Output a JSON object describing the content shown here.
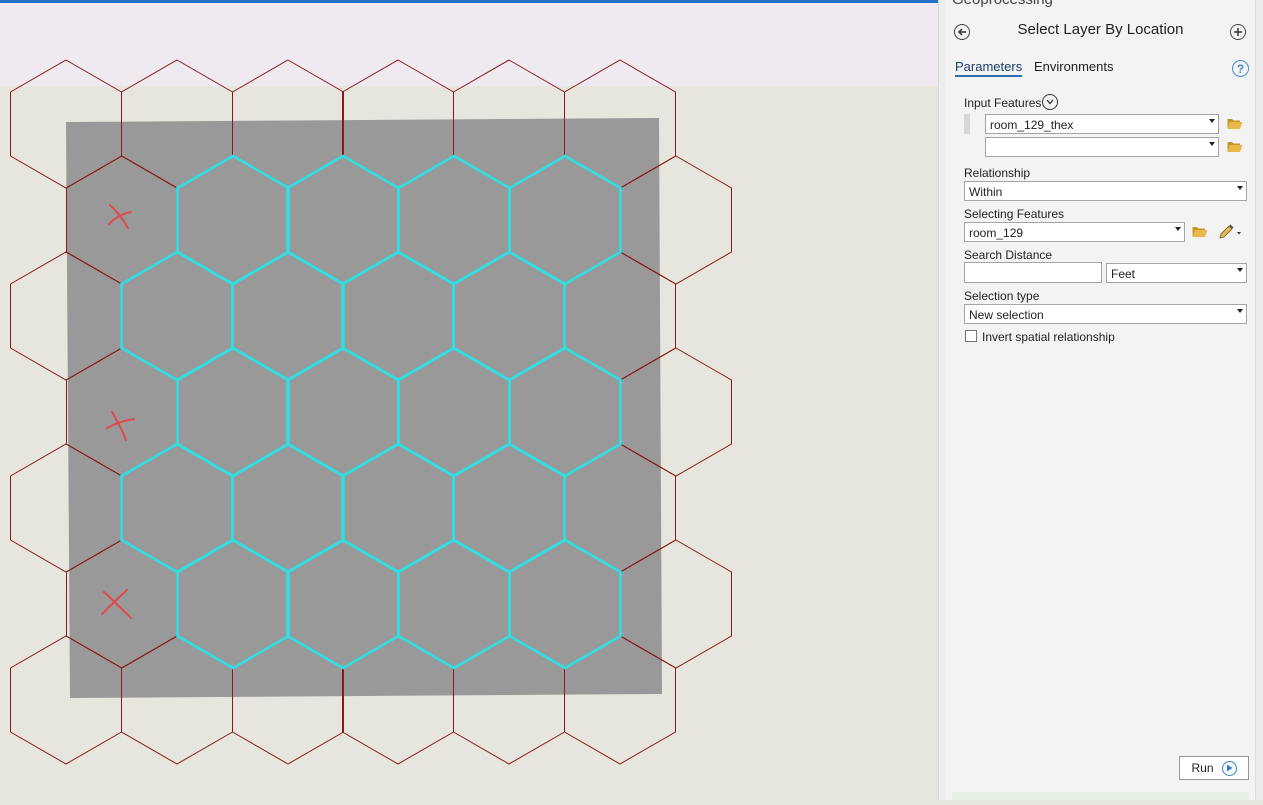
{
  "geoprocessing_pane": {
    "pane_title": "Geoprocessing",
    "back_icon": "arrow-left-circle-icon",
    "add_icon": "plus-circle-icon",
    "tool_title": "Select Layer By Location",
    "tabs": [
      {
        "label": "Parameters",
        "active": true
      },
      {
        "label": "Environments",
        "active": false
      }
    ],
    "help_label": "?",
    "input_features": {
      "label": "Input Features",
      "values": [
        "room_129_thex",
        ""
      ]
    },
    "relationship": {
      "label": "Relationship",
      "value": "Within"
    },
    "selecting_features": {
      "label": "Selecting Features",
      "value": "room_129"
    },
    "search_distance": {
      "label": "Search Distance",
      "value": "",
      "unit": "Feet"
    },
    "selection_type": {
      "label": "Selection type",
      "value": "New selection"
    },
    "invert": {
      "label": "Invert spatial relationship",
      "checked": false
    },
    "run_label": "Run",
    "colors": {
      "accent": "#2c6fb5",
      "folder": "#d9a630"
    }
  },
  "map": {
    "colors": {
      "room_polygon": "#999999",
      "hex_outline": "#8b1a1a",
      "selected_hex": "#2de0e6",
      "annotation_x": "#e04a4a",
      "basemap": "#e6e5de",
      "top_band": "#eeeaf0",
      "top_line": "#2372c4"
    },
    "icon_names": [
      "x-mark",
      "x-mark",
      "x-mark"
    ]
  }
}
